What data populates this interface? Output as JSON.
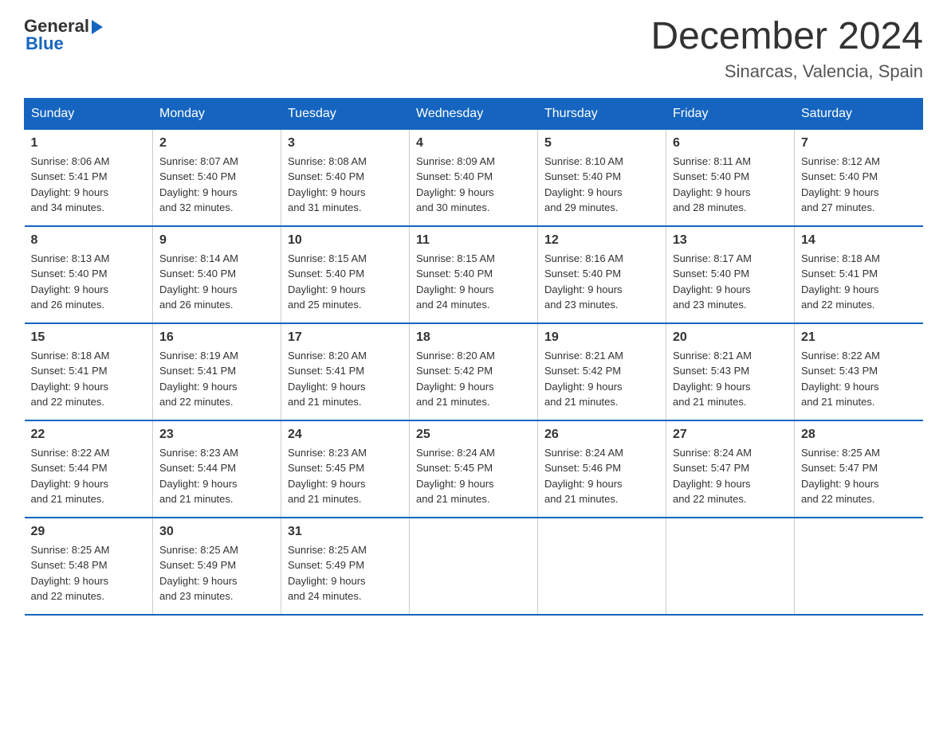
{
  "header": {
    "logo_general": "General",
    "logo_blue": "Blue",
    "month_title": "December 2024",
    "subtitle": "Sinarcas, Valencia, Spain"
  },
  "days_of_week": [
    "Sunday",
    "Monday",
    "Tuesday",
    "Wednesday",
    "Thursday",
    "Friday",
    "Saturday"
  ],
  "weeks": [
    [
      {
        "day": "1",
        "sunrise": "8:06 AM",
        "sunset": "5:41 PM",
        "daylight": "9 hours and 34 minutes."
      },
      {
        "day": "2",
        "sunrise": "8:07 AM",
        "sunset": "5:40 PM",
        "daylight": "9 hours and 32 minutes."
      },
      {
        "day": "3",
        "sunrise": "8:08 AM",
        "sunset": "5:40 PM",
        "daylight": "9 hours and 31 minutes."
      },
      {
        "day": "4",
        "sunrise": "8:09 AM",
        "sunset": "5:40 PM",
        "daylight": "9 hours and 30 minutes."
      },
      {
        "day": "5",
        "sunrise": "8:10 AM",
        "sunset": "5:40 PM",
        "daylight": "9 hours and 29 minutes."
      },
      {
        "day": "6",
        "sunrise": "8:11 AM",
        "sunset": "5:40 PM",
        "daylight": "9 hours and 28 minutes."
      },
      {
        "day": "7",
        "sunrise": "8:12 AM",
        "sunset": "5:40 PM",
        "daylight": "9 hours and 27 minutes."
      }
    ],
    [
      {
        "day": "8",
        "sunrise": "8:13 AM",
        "sunset": "5:40 PM",
        "daylight": "9 hours and 26 minutes."
      },
      {
        "day": "9",
        "sunrise": "8:14 AM",
        "sunset": "5:40 PM",
        "daylight": "9 hours and 26 minutes."
      },
      {
        "day": "10",
        "sunrise": "8:15 AM",
        "sunset": "5:40 PM",
        "daylight": "9 hours and 25 minutes."
      },
      {
        "day": "11",
        "sunrise": "8:15 AM",
        "sunset": "5:40 PM",
        "daylight": "9 hours and 24 minutes."
      },
      {
        "day": "12",
        "sunrise": "8:16 AM",
        "sunset": "5:40 PM",
        "daylight": "9 hours and 23 minutes."
      },
      {
        "day": "13",
        "sunrise": "8:17 AM",
        "sunset": "5:40 PM",
        "daylight": "9 hours and 23 minutes."
      },
      {
        "day": "14",
        "sunrise": "8:18 AM",
        "sunset": "5:41 PM",
        "daylight": "9 hours and 22 minutes."
      }
    ],
    [
      {
        "day": "15",
        "sunrise": "8:18 AM",
        "sunset": "5:41 PM",
        "daylight": "9 hours and 22 minutes."
      },
      {
        "day": "16",
        "sunrise": "8:19 AM",
        "sunset": "5:41 PM",
        "daylight": "9 hours and 22 minutes."
      },
      {
        "day": "17",
        "sunrise": "8:20 AM",
        "sunset": "5:41 PM",
        "daylight": "9 hours and 21 minutes."
      },
      {
        "day": "18",
        "sunrise": "8:20 AM",
        "sunset": "5:42 PM",
        "daylight": "9 hours and 21 minutes."
      },
      {
        "day": "19",
        "sunrise": "8:21 AM",
        "sunset": "5:42 PM",
        "daylight": "9 hours and 21 minutes."
      },
      {
        "day": "20",
        "sunrise": "8:21 AM",
        "sunset": "5:43 PM",
        "daylight": "9 hours and 21 minutes."
      },
      {
        "day": "21",
        "sunrise": "8:22 AM",
        "sunset": "5:43 PM",
        "daylight": "9 hours and 21 minutes."
      }
    ],
    [
      {
        "day": "22",
        "sunrise": "8:22 AM",
        "sunset": "5:44 PM",
        "daylight": "9 hours and 21 minutes."
      },
      {
        "day": "23",
        "sunrise": "8:23 AM",
        "sunset": "5:44 PM",
        "daylight": "9 hours and 21 minutes."
      },
      {
        "day": "24",
        "sunrise": "8:23 AM",
        "sunset": "5:45 PM",
        "daylight": "9 hours and 21 minutes."
      },
      {
        "day": "25",
        "sunrise": "8:24 AM",
        "sunset": "5:45 PM",
        "daylight": "9 hours and 21 minutes."
      },
      {
        "day": "26",
        "sunrise": "8:24 AM",
        "sunset": "5:46 PM",
        "daylight": "9 hours and 21 minutes."
      },
      {
        "day": "27",
        "sunrise": "8:24 AM",
        "sunset": "5:47 PM",
        "daylight": "9 hours and 22 minutes."
      },
      {
        "day": "28",
        "sunrise": "8:25 AM",
        "sunset": "5:47 PM",
        "daylight": "9 hours and 22 minutes."
      }
    ],
    [
      {
        "day": "29",
        "sunrise": "8:25 AM",
        "sunset": "5:48 PM",
        "daylight": "9 hours and 22 minutes."
      },
      {
        "day": "30",
        "sunrise": "8:25 AM",
        "sunset": "5:49 PM",
        "daylight": "9 hours and 23 minutes."
      },
      {
        "day": "31",
        "sunrise": "8:25 AM",
        "sunset": "5:49 PM",
        "daylight": "9 hours and 24 minutes."
      },
      null,
      null,
      null,
      null
    ]
  ],
  "labels": {
    "sunrise": "Sunrise:",
    "sunset": "Sunset:",
    "daylight": "Daylight:"
  }
}
